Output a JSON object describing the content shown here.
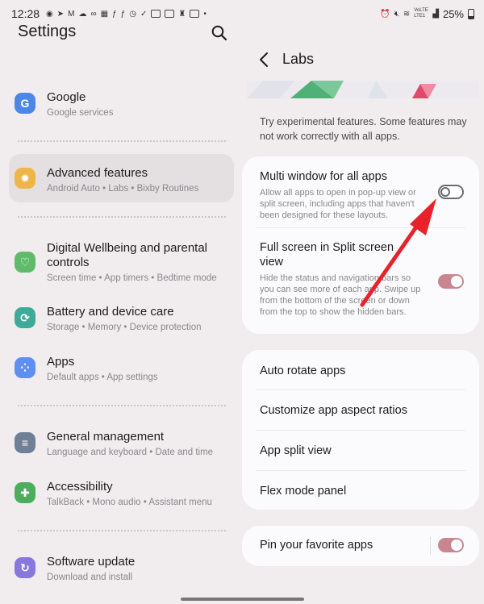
{
  "status_bar": {
    "time": "12:28",
    "battery": "25%",
    "network_label": "VoLTE LTE1"
  },
  "left_pane": {
    "title": "Settings",
    "items": [
      {
        "title": "Google",
        "subtitle": "Google services",
        "icon": "google-icon",
        "color": "#4e86e8"
      },
      {
        "title": "Advanced features",
        "subtitle": "Android Auto  •  Labs  •  Bixby Routines",
        "icon": "star-gear-icon",
        "color": "#f0b548",
        "selected": true
      },
      {
        "title": "Digital Wellbeing and parental controls",
        "subtitle": "Screen time  •  App timers  •  Bedtime mode",
        "icon": "heart-ring-icon",
        "color": "#5fbb6a"
      },
      {
        "title": "Battery and device care",
        "subtitle": "Storage  •  Memory  •  Device protection",
        "icon": "refresh-ring-icon",
        "color": "#3eaa9a"
      },
      {
        "title": "Apps",
        "subtitle": "Default apps  •  App settings",
        "icon": "apps-grid-icon",
        "color": "#5f8ff0"
      },
      {
        "title": "General management",
        "subtitle": "Language and keyboard  •  Date and time",
        "icon": "sliders-icon",
        "color": "#6e7f96"
      },
      {
        "title": "Accessibility",
        "subtitle": "TalkBack  •  Mono audio  •  Assistant menu",
        "icon": "person-icon",
        "color": "#4cae5c"
      },
      {
        "title": "Software update",
        "subtitle": "Download and install",
        "icon": "update-icon",
        "color": "#8877dd"
      }
    ]
  },
  "right_pane": {
    "title": "Labs",
    "intro": "Try experimental features. Some features may not work correctly with all apps.",
    "features": [
      {
        "title": "Multi window for all apps",
        "subtitle": "Allow all apps to open in pop-up view or split screen, including apps that haven't been designed for these layouts.",
        "enabled": false
      },
      {
        "title": "Full screen in Split screen view",
        "subtitle": "Hide the status and navigation bars so you can see more of each app. Swipe up from the bottom of the screen or down from the top to show the hidden bars.",
        "enabled": true
      }
    ],
    "options": [
      {
        "title": "Auto rotate apps"
      },
      {
        "title": "Customize app aspect ratios"
      },
      {
        "title": "App split view"
      },
      {
        "title": "Flex mode panel"
      }
    ],
    "pin_row": {
      "title": "Pin your favorite apps",
      "enabled": true
    }
  },
  "colors": {
    "accent_toggle_on": "#c98690",
    "annotation_arrow": "#e8222a",
    "background": "#f1edef",
    "card": "#fbfbfd"
  }
}
